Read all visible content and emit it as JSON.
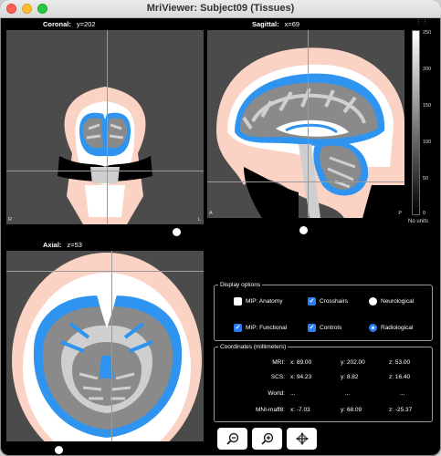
{
  "window": {
    "title": "MriViewer: Subject09 (Tissues)"
  },
  "views": {
    "coronal": {
      "name": "Coronal:",
      "coord": "y=202",
      "left": "R",
      "right": "L"
    },
    "sagittal": {
      "name": "Sagittal:",
      "coord": "x=69",
      "left": "A",
      "right": "P"
    },
    "axial": {
      "name": "Axial:",
      "coord": "z=53"
    }
  },
  "colorbar": {
    "ticks": [
      "250",
      "200",
      "150",
      "100",
      "50",
      "0"
    ],
    "units": "No units"
  },
  "display_options": {
    "title": "Display options",
    "mip_anatomy": {
      "label": "MIP: Anatomy",
      "checked": false
    },
    "crosshairs": {
      "label": "Crosshairs",
      "checked": true
    },
    "neurological": {
      "label": "Neurological",
      "selected": false
    },
    "mip_functional": {
      "label": "MIP: Functional",
      "checked": true
    },
    "controls": {
      "label": "Controls",
      "checked": true
    },
    "radiological": {
      "label": "Radiological",
      "selected": true
    }
  },
  "coordinates": {
    "title": "Coordinates (millimeters)",
    "rows": [
      {
        "label": "MRI:",
        "x": "x: 89.00",
        "y": "y: 202.00",
        "z": "z: 53.00"
      },
      {
        "label": "SCS:",
        "x": "x: 94.23",
        "y": "y: 8.82",
        "z": "z: 16.40"
      },
      {
        "label": "World:",
        "x": "...",
        "y": "...",
        "z": "..."
      },
      {
        "label": "MNI-maff8:",
        "x": "x: -7.03",
        "y": "y: 68.09",
        "z": "z: -25.37"
      }
    ]
  },
  "colors": {
    "tissue_skin": "#fbd3c4",
    "tissue_csf": "#2e94f0",
    "tissue_gray": "#8a8a8a",
    "tissue_white": "#cfcfcf",
    "accent": "#2a7ff6"
  },
  "toolbar": {
    "buttons": [
      "zoom-out-icon",
      "zoom-in-icon",
      "move-icon"
    ]
  }
}
